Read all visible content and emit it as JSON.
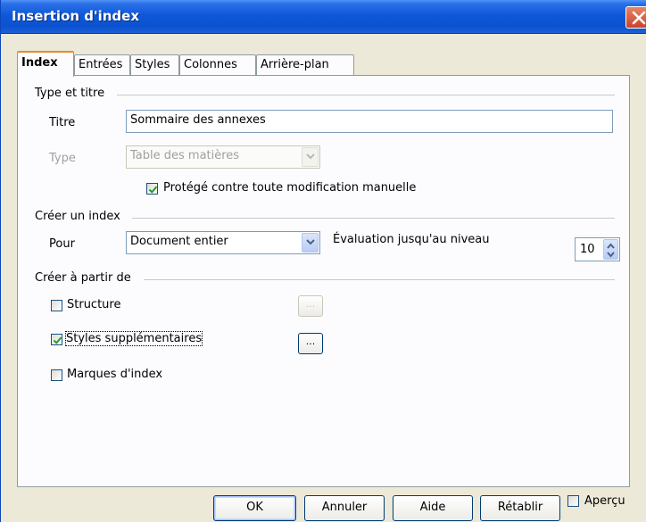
{
  "window": {
    "title": "Insertion d'index"
  },
  "tabs": [
    {
      "label": "Index",
      "active": true
    },
    {
      "label": "Entrées"
    },
    {
      "label": "Styles"
    },
    {
      "label": "Colonnes"
    },
    {
      "label": "Arrière-plan"
    }
  ],
  "type_section": {
    "heading": "Type et titre",
    "title_label": "Titre",
    "title_value": "Sommaire des annexes",
    "type_label": "Type",
    "type_value": "Table des matières",
    "protect_label": "Protégé contre toute modification manuelle",
    "protect_checked": true
  },
  "create_section": {
    "heading": "Créer un index",
    "for_label": "Pour",
    "for_value": "Document entier",
    "eval_label": "Évaluation jusqu'au niveau",
    "level_value": "10"
  },
  "source_section": {
    "heading": "Créer à partir de",
    "structure_label": "Structure",
    "structure_checked": false,
    "styles_label": "Styles supplémentaires",
    "styles_checked": true,
    "marks_label": "Marques d'index",
    "marks_checked": false,
    "ellipsis": "..."
  },
  "buttons": {
    "ok": "OK",
    "cancel": "Annuler",
    "help": "Aide",
    "reset": "Rétablir",
    "preview": "Aperçu"
  },
  "colors": {
    "titlebar": "#0b52d0",
    "dialog_bg": "#ece9d8",
    "tab_accent": "#e68b2c",
    "check": "#21a121"
  }
}
